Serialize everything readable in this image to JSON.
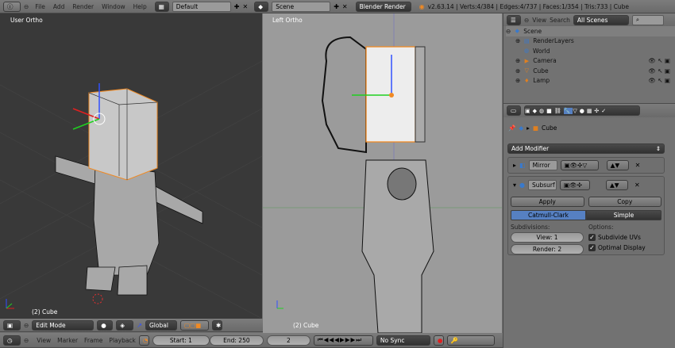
{
  "topbar": {
    "menus": [
      "File",
      "Add",
      "Render",
      "Window",
      "Help"
    ],
    "layout": "Default",
    "scene": "Scene",
    "engine": "Blender Render",
    "stats": "v2.63.14 | Verts:4/384 | Edges:4/737 | Faces:1/354 | Tris:733 | Cube"
  },
  "viewport_left": {
    "label": "User Ortho",
    "object": "(2) Cube",
    "bg": "#393939"
  },
  "viewport_mid": {
    "label": "Left Ortho",
    "object": "(2) Cube",
    "bg": "#9b9b9b"
  },
  "view3d_header": {
    "mode": "Edit Mode",
    "orientation": "Global"
  },
  "timeline": {
    "menus": [
      "View",
      "Marker",
      "Frame",
      "Playback"
    ],
    "start": "Start: 1",
    "end": "End: 250",
    "frame": "2",
    "sync": "No Sync"
  },
  "outliner": {
    "menus": [
      "View",
      "Search"
    ],
    "filter": "All Scenes",
    "items": [
      {
        "label": "Scene",
        "icon": "scene-icon"
      },
      {
        "label": "RenderLayers",
        "icon": "renderlayers-icon"
      },
      {
        "label": "World",
        "icon": "world-icon"
      },
      {
        "label": "Camera",
        "icon": "camera-icon"
      },
      {
        "label": "Cube",
        "icon": "mesh-icon"
      },
      {
        "label": "Lamp",
        "icon": "lamp-icon"
      }
    ]
  },
  "properties": {
    "breadcrumb": "Cube",
    "add_modifier": "Add Modifier",
    "mirror": {
      "name": "Mirror"
    },
    "subsurf": {
      "name": "Subsurf",
      "apply": "Apply",
      "copy": "Copy",
      "type_options": [
        "Catmull-Clark",
        "Simple"
      ],
      "active_type": "Catmull-Clark",
      "subdivisions_label": "Subdivisions:",
      "view": "View: 1",
      "render": "Render: 2",
      "options_label": "Options:",
      "subdivide_uvs": "Subdivide UVs",
      "optimal_display": "Optimal Display"
    }
  },
  "colors": {
    "accent": "#5680c2",
    "selection": "#f08a24"
  }
}
